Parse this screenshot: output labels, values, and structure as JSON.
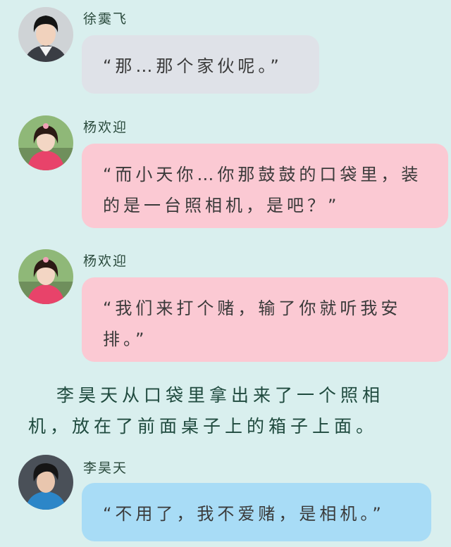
{
  "messages": [
    {
      "speaker": "徐霙飞",
      "text": "“那…那个家伙呢。”"
    },
    {
      "speaker": "杨欢迎",
      "text": "“而小天你…你那鼓鼓的口袋里，装的是一台照相机，是吧？”"
    },
    {
      "speaker": "杨欢迎",
      "text": "“我们来打个赌，输了你就听我安排。”"
    },
    {
      "speaker": "李昊天",
      "text": "“不用了，我不爱赌，是相机。”"
    }
  ],
  "narration": "李昊天从口袋里拿出来了一个照相机，放在了前面桌子上的箱子上面。",
  "colors": {
    "background": "#d9efee",
    "bubble_gray": "#dfe2e8",
    "bubble_pink": "#fbc9d3",
    "bubble_blue": "#a8dcf6"
  }
}
